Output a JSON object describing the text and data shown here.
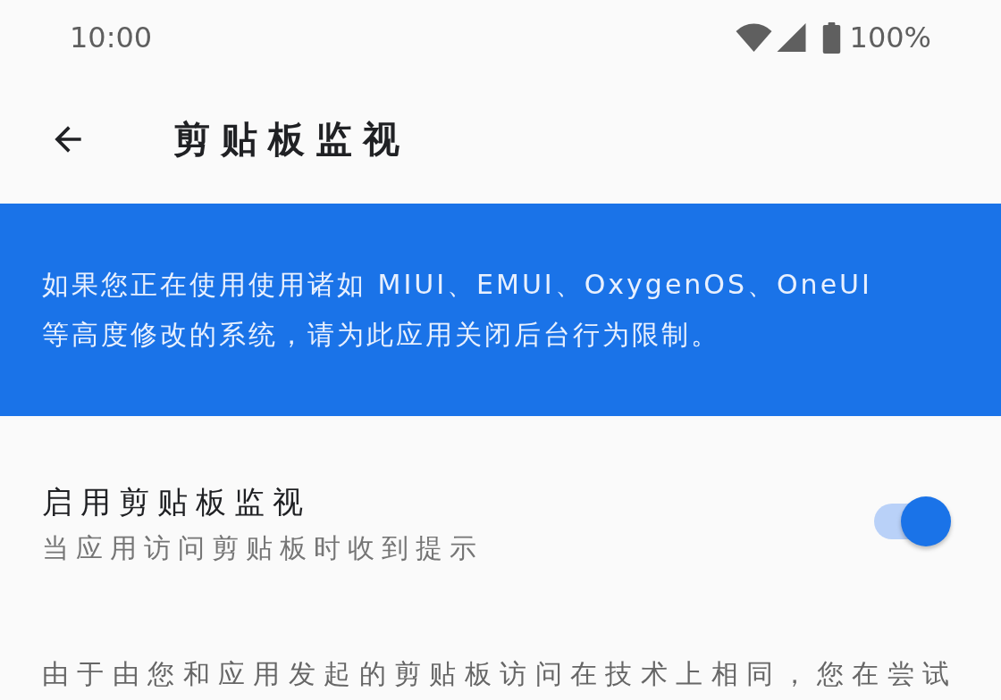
{
  "status_bar": {
    "time": "10:00",
    "battery": "100%"
  },
  "app_bar": {
    "title": "剪贴板监视"
  },
  "banner": {
    "text": "如果您正在使用使用诸如 MIUI、EMUI、OxygenOS、OneUI 等高度修改的系统，请为此应用关闭后台行为限制。"
  },
  "setting": {
    "title": "启用剪贴板监视",
    "subtitle": "当应用访问剪贴板时收到提示",
    "on": true
  },
  "description": "由于由您和应用发起的剪贴板访问在技术上相同，您在尝试"
}
